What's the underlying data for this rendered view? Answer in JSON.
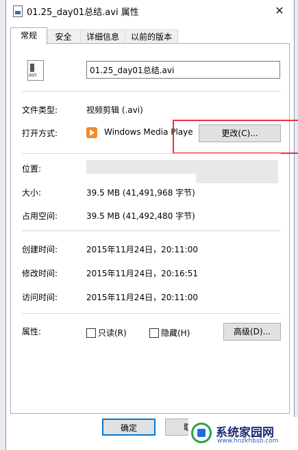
{
  "window": {
    "title": "01.25_day01总结.avi 属性",
    "close_glyph": "✕"
  },
  "tabs": [
    "常规",
    "安全",
    "详细信息",
    "以前的版本"
  ],
  "file": {
    "icon_label": "AVI",
    "name": "01.25_day01总结.avi"
  },
  "props": {
    "type_label": "文件类型:",
    "type_value": "视频剪辑 (.avi)",
    "open_label": "打开方式:",
    "open_value": "Windows Media Playe",
    "change_button": "更改(C)...",
    "location_label": "位置:",
    "size_label": "大小:",
    "size_value": "39.5 MB (41,491,968 字节)",
    "disk_label": "占用空间:",
    "disk_value": "39.5 MB (41,492,480 字节)",
    "created_label": "创建时间:",
    "created_value": "2015年11月24日，20:11:00",
    "modified_label": "修改时间:",
    "modified_value": "2015年11月24日，20:16:51",
    "accessed_label": "访问时间:",
    "accessed_value": "2015年11月24日，20:11:00",
    "attrs_label": "属性:",
    "readonly_label": "只读(R)",
    "hidden_label": "隐藏(H)",
    "advanced_button": "高级(D)..."
  },
  "footer": {
    "ok_button": "确定",
    "cancel_button": "取消"
  },
  "watermark": {
    "name": "系统家园网",
    "url": "www.hnzkhbsb.com"
  },
  "colors": {
    "highlight": "#e8303a",
    "button_bg": "#e1e1e1",
    "media_icon": "#f28c1e"
  }
}
